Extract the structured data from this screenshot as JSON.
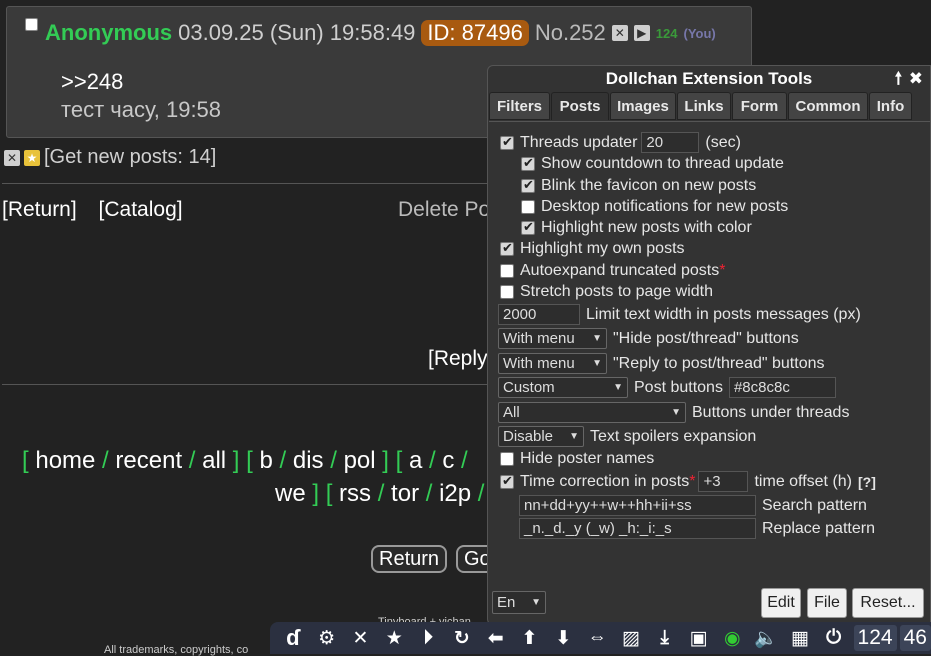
{
  "post": {
    "name": "Anonymous",
    "date": "03.09.25 (Sun) 19:58:49",
    "id_label": "ID: 87496",
    "number": "No.252",
    "reply_count": "124",
    "you_label": "(You)",
    "reply_link": ">>248",
    "message": "тест часу, 19:58"
  },
  "thread": {
    "get_new_label": "[Get new posts:",
    "get_new_count": "14",
    "get_new_close": "]",
    "return_link": "[Return]",
    "catalog_link": "[Catalog]",
    "delete_label": "Delete Po",
    "reply_label": "[Reply"
  },
  "boards": {
    "group1": [
      "home",
      "recent",
      "all"
    ],
    "group2": [
      "b",
      "dis",
      "pol"
    ],
    "group3_partial": [
      "a",
      "c"
    ],
    "line2_start": "we",
    "group4": [
      "rss",
      "tor",
      "i2p"
    ]
  },
  "bottom_buttons": {
    "return": "Return",
    "go": "Go"
  },
  "footer": {
    "line1": "Tinyboard + vichan",
    "line2": "All trademarks, copyrights, co"
  },
  "panel": {
    "title": "Dollchan Extension Tools",
    "tabs": [
      "Filters",
      "Posts",
      "Images",
      "Links",
      "Form",
      "Common",
      "Info"
    ],
    "active_tab": "Posts",
    "settings": {
      "threads_updater": {
        "label": "Threads updater",
        "value": "20",
        "unit": "(sec)",
        "checked": true
      },
      "show_countdown": {
        "label": "Show countdown to thread update",
        "checked": true
      },
      "blink_favicon": {
        "label": "Blink the favicon on new posts",
        "checked": true
      },
      "desktop_notifications": {
        "label": "Desktop notifications for new posts",
        "checked": false
      },
      "highlight_new": {
        "label": "Highlight new posts with color",
        "checked": true
      },
      "highlight_own": {
        "label": "Highlight my own posts",
        "checked": true
      },
      "autoexpand": {
        "label": "Autoexpand truncated posts",
        "mark": "*",
        "checked": false
      },
      "stretch": {
        "label": "Stretch posts to page width",
        "checked": false
      },
      "limit_width": {
        "value": "2000",
        "label": "Limit text width in posts messages (px)"
      },
      "hide_buttons": {
        "selected": "With menu",
        "label": "\"Hide post/thread\" buttons"
      },
      "reply_buttons": {
        "selected": "With menu",
        "label": "\"Reply to post/thread\" buttons"
      },
      "post_buttons": {
        "selected": "Custom",
        "label": "Post buttons",
        "color": "#8c8c8c"
      },
      "under_threads": {
        "selected": "All",
        "label": "Buttons under threads"
      },
      "spoilers": {
        "selected": "Disable",
        "label": "Text spoilers expansion"
      },
      "hide_names": {
        "label": "Hide poster names",
        "checked": false
      },
      "time_correction": {
        "label": "Time correction in posts",
        "mark": "*",
        "value": "+3",
        "offset_label": "time offset (h)",
        "help": "[?]",
        "checked": true
      },
      "search_pattern": {
        "value": "nn+dd+yy++w++hh+ii+ss",
        "label": "Search pattern"
      },
      "replace_pattern": {
        "value": "_n._d._y (_w) _h:_i:_s",
        "label": "Replace pattern"
      }
    },
    "language": "En",
    "buttons": {
      "edit": "Edit",
      "file": "File",
      "reset": "Reset..."
    }
  },
  "toolbar": {
    "icons": [
      "de-logo-icon",
      "gear-icon",
      "close-icon",
      "star-icon",
      "play-icon",
      "refresh-icon",
      "arrow-left-icon",
      "arrow-up-icon",
      "arrow-down-icon",
      "expand-icon",
      "hatch-icon",
      "download-icon",
      "save-icon",
      "eye-icon",
      "mute-icon",
      "grid-icon",
      "power-icon"
    ],
    "count_posts": "124",
    "count_files": "46"
  }
}
